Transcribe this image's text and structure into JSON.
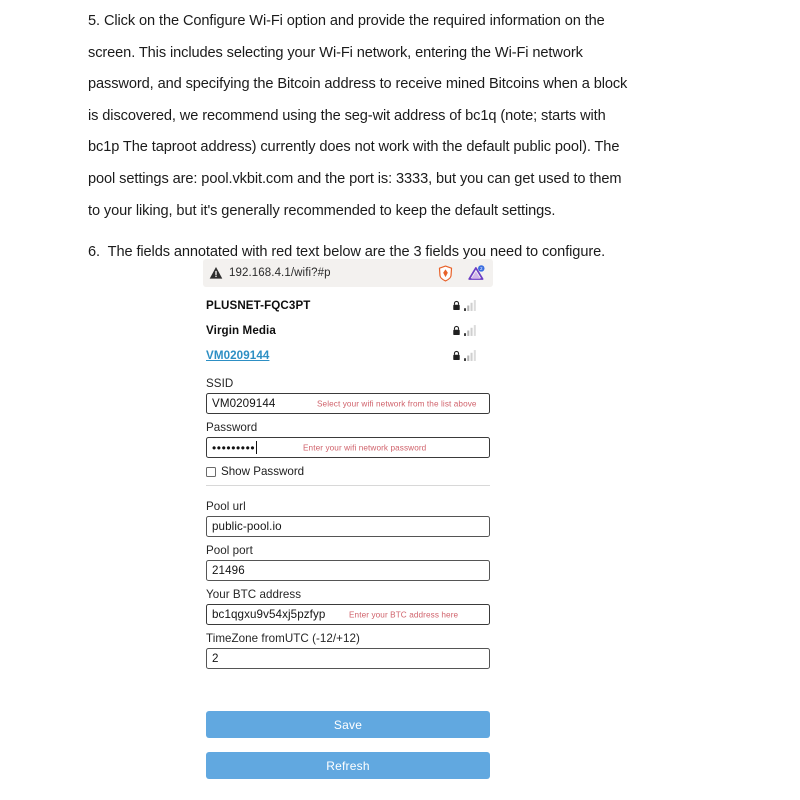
{
  "document": {
    "step5": {
      "marker": "5.",
      "lines": [
        "Click on the Configure Wi-Fi option and provide the required information on the",
        "screen. This includes selecting your Wi-Fi network, entering the Wi-Fi network",
        "password, and specifying the Bitcoin address to receive mined Bitcoins when a block",
        "is discovered, we recommend using the seg-wit address of bc1q (note; starts with",
        "bc1p The taproot address) currently does not work with the default public pool). The",
        "pool settings are: pool.vkbit.com and the port is: 3333, but you can get used to them",
        "to your liking, but it's generally recommended to keep the default settings."
      ]
    },
    "step6": {
      "marker": "6.",
      "text": "The fields annotated with red text below are the 3 fields you need to configure."
    }
  },
  "screenshot": {
    "browser": {
      "url": "192.168.4.1/wifi?#p",
      "warning_icon": "warning-triangle-icon",
      "brave_icon": "brave-shield-icon",
      "extension_icon": "extension-triangle-icon",
      "extension_badge": "2"
    },
    "wifi_networks": [
      {
        "ssid": "PLUSNET-FQC3PT",
        "is_link": false,
        "secured": true,
        "signal": 2
      },
      {
        "ssid": "Virgin Media",
        "is_link": false,
        "secured": true,
        "signal": 2
      },
      {
        "ssid": "VM0209144",
        "is_link": true,
        "secured": true,
        "signal": 2
      }
    ],
    "form": {
      "ssid": {
        "label": "SSID",
        "value": "VM0209144",
        "annotation": "Select your wifi network from the list above"
      },
      "password": {
        "label": "Password",
        "value": "•••••••••",
        "annotation": "Enter your wifi network password"
      },
      "show_password": {
        "label": "Show Password",
        "checked": false
      },
      "pool_url": {
        "label": "Pool url",
        "value": "public-pool.io"
      },
      "pool_port": {
        "label": "Pool port",
        "value": "21496"
      },
      "btc_address": {
        "label": "Your BTC address",
        "value": "bc1qgxu9v54xj5pzfyp",
        "annotation": "Enter your BTC address here"
      },
      "timezone": {
        "label": "TimeZone fromUTC (-12/+12)",
        "value": "2"
      }
    },
    "buttons": {
      "save": "Save",
      "refresh": "Refresh"
    },
    "colors": {
      "button_blue": "#61a8e0",
      "annotation_red": "#d0626b",
      "link_blue": "#2d8fc4",
      "urlbar_bg": "#f3f1ef"
    }
  }
}
